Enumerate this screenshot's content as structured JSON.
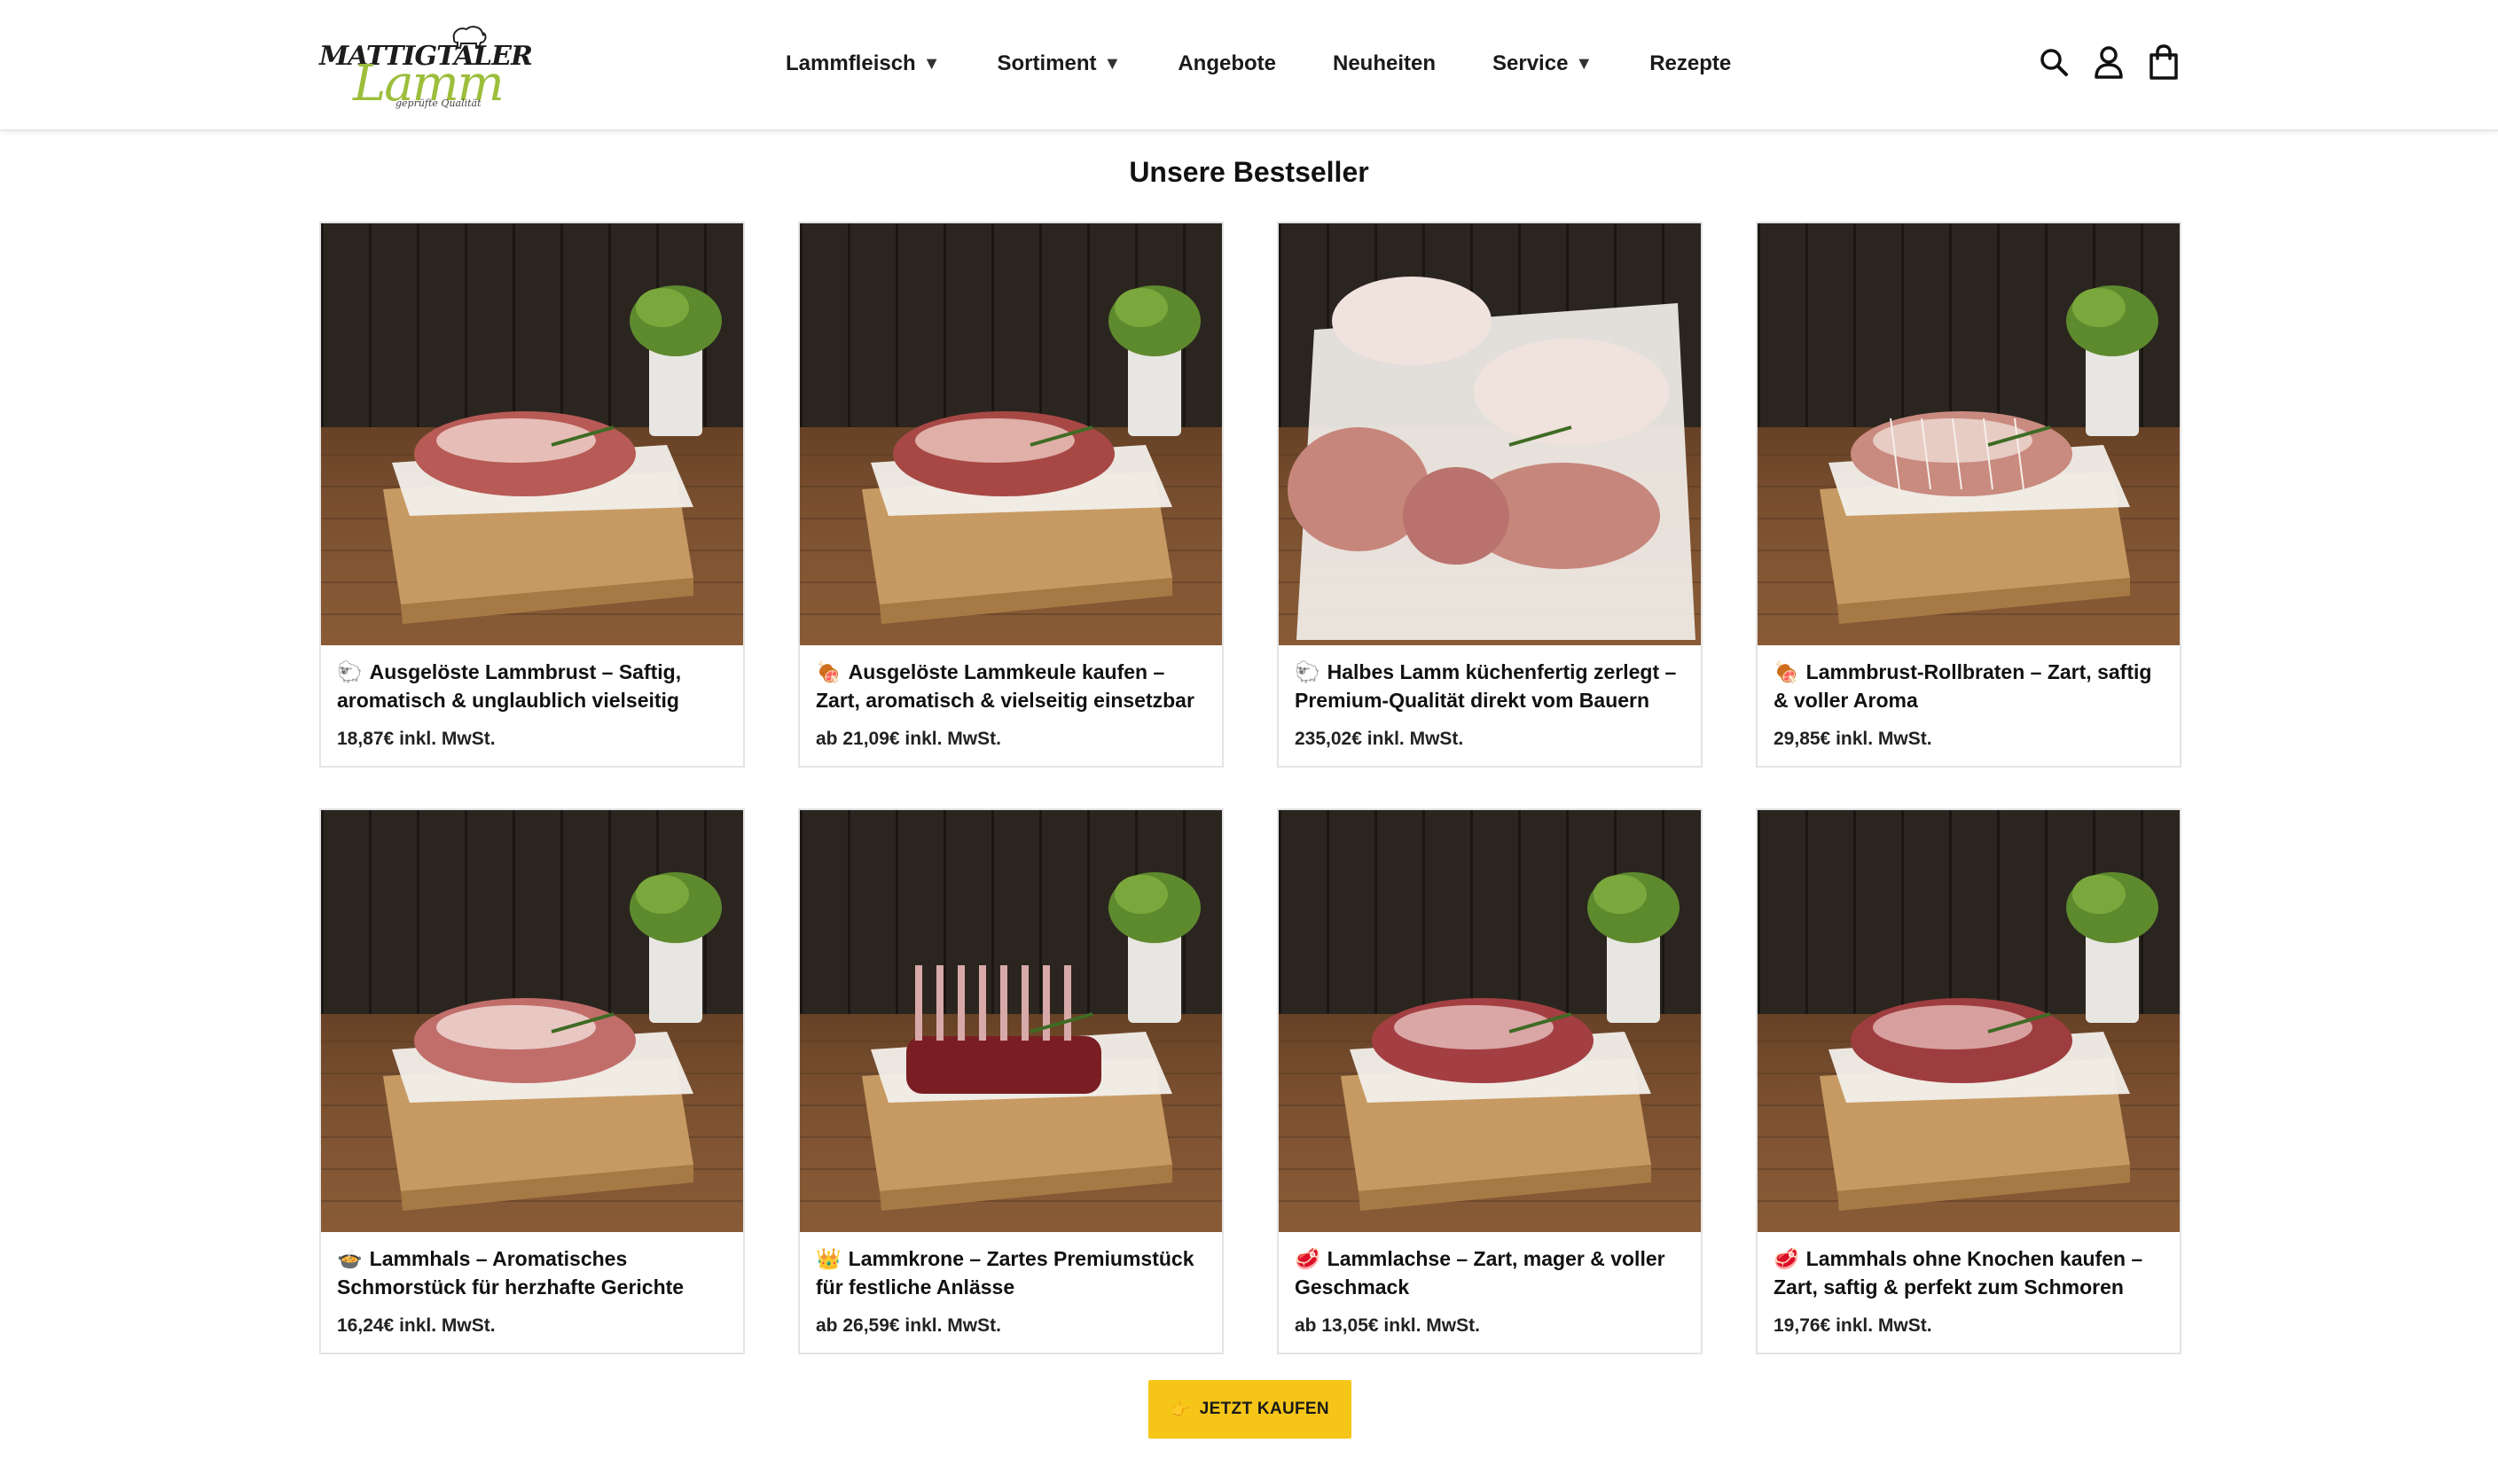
{
  "logo": {
    "top_text": "MATTIGTALER",
    "main_text": "Lamm",
    "sub_text": "geprüfte Qualität"
  },
  "nav": {
    "items": [
      {
        "label": "Lammfleisch",
        "dropdown": true
      },
      {
        "label": "Sortiment",
        "dropdown": true
      },
      {
        "label": "Angebote",
        "dropdown": false
      },
      {
        "label": "Neuheiten",
        "dropdown": false
      },
      {
        "label": "Service",
        "dropdown": true
      },
      {
        "label": "Rezepte",
        "dropdown": false
      }
    ],
    "caret": "▼"
  },
  "header_icons": [
    "search-icon",
    "account-icon",
    "cart-icon"
  ],
  "section": {
    "title": "Unsere Bestseller"
  },
  "products": [
    {
      "emoji": "🐑",
      "title": "Ausgelöste Lammbrust – Saftig, aromatisch & unglaublich vielseitig",
      "price": "18,87€ inkl. MwSt.",
      "image": "lamb-breast-photo"
    },
    {
      "emoji": "🍖",
      "title": "Ausgelöste Lammkeule kaufen – Zart, aromatisch & vielseitig einsetzbar",
      "price": "ab 21,09€ inkl. MwSt.",
      "image": "lamb-leg-photo"
    },
    {
      "emoji": "🐑",
      "title": "Halbes Lamm küchenfertig zerlegt – Premium-Qualität direkt vom Bauern",
      "price": "235,02€ inkl. MwSt.",
      "image": "half-lamb-photo"
    },
    {
      "emoji": "🍖",
      "title": "Lammbrust-Rollbraten – Zart, saftig & voller Aroma",
      "price": "29,85€ inkl. MwSt.",
      "image": "rolled-roast-photo"
    },
    {
      "emoji": "🍲",
      "title": "Lammhals – Aromatisches Schmorstück für herzhafte Gerichte",
      "price": "16,24€ inkl. MwSt.",
      "image": "lamb-neck-photo"
    },
    {
      "emoji": "👑",
      "title": "Lammkrone – Zartes Premiumstück für festliche Anlässe",
      "price": "ab 26,59€ inkl. MwSt.",
      "image": "lamb-rack-photo"
    },
    {
      "emoji": "🥩",
      "title": "Lammlachse – Zart, mager & voller Geschmack",
      "price": "ab 13,05€ inkl. MwSt.",
      "image": "lamb-loin-photo"
    },
    {
      "emoji": "🥩",
      "title": "Lammhals ohne Knochen kaufen – Zart, saftig & perfekt zum Schmoren",
      "price": "19,76€ inkl. MwSt.",
      "image": "boneless-neck-photo"
    }
  ],
  "cta": {
    "icon": "👉",
    "label": "JETZT KAUFEN"
  },
  "colors": {
    "cta_bg": "#f5c518",
    "logo_green": "#9cbe3b",
    "wood_dark": "#2a241f",
    "wood_table": "#7a4f2e"
  }
}
